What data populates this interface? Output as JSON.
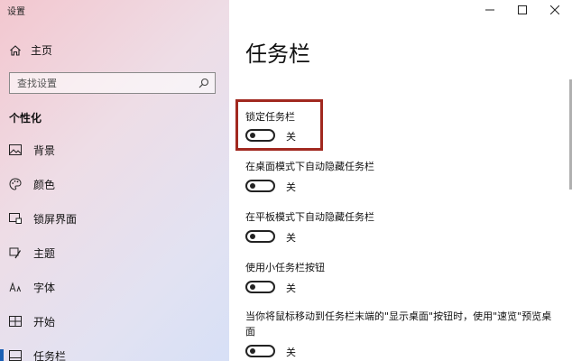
{
  "window": {
    "title": "设置"
  },
  "sidebar": {
    "home_label": "主页",
    "search_placeholder": "查找设置",
    "section_title": "个性化",
    "items": [
      {
        "label": "背景",
        "icon": "picture-icon"
      },
      {
        "label": "颜色",
        "icon": "palette-icon"
      },
      {
        "label": "锁屏界面",
        "icon": "lock-screen-icon"
      },
      {
        "label": "主题",
        "icon": "theme-brush-icon"
      },
      {
        "label": "字体",
        "icon": "font-icon"
      },
      {
        "label": "开始",
        "icon": "start-grid-icon"
      },
      {
        "label": "任务栏",
        "icon": "taskbar-icon"
      }
    ]
  },
  "main": {
    "title": "任务栏",
    "settings": [
      {
        "label": "锁定任务栏",
        "state": "关"
      },
      {
        "label": "在桌面模式下自动隐藏任务栏",
        "state": "关"
      },
      {
        "label": "在平板模式下自动隐藏任务栏",
        "state": "关"
      },
      {
        "label": "使用小任务栏按钮",
        "state": "关"
      },
      {
        "label": "当你将鼠标移动到任务栏末端的\"显示桌面\"按钮时，使用\"速览\"预览桌面",
        "state": "关"
      }
    ]
  },
  "colors": {
    "highlight_border": "#a1281f",
    "active_indicator": "#1a5fb4"
  }
}
